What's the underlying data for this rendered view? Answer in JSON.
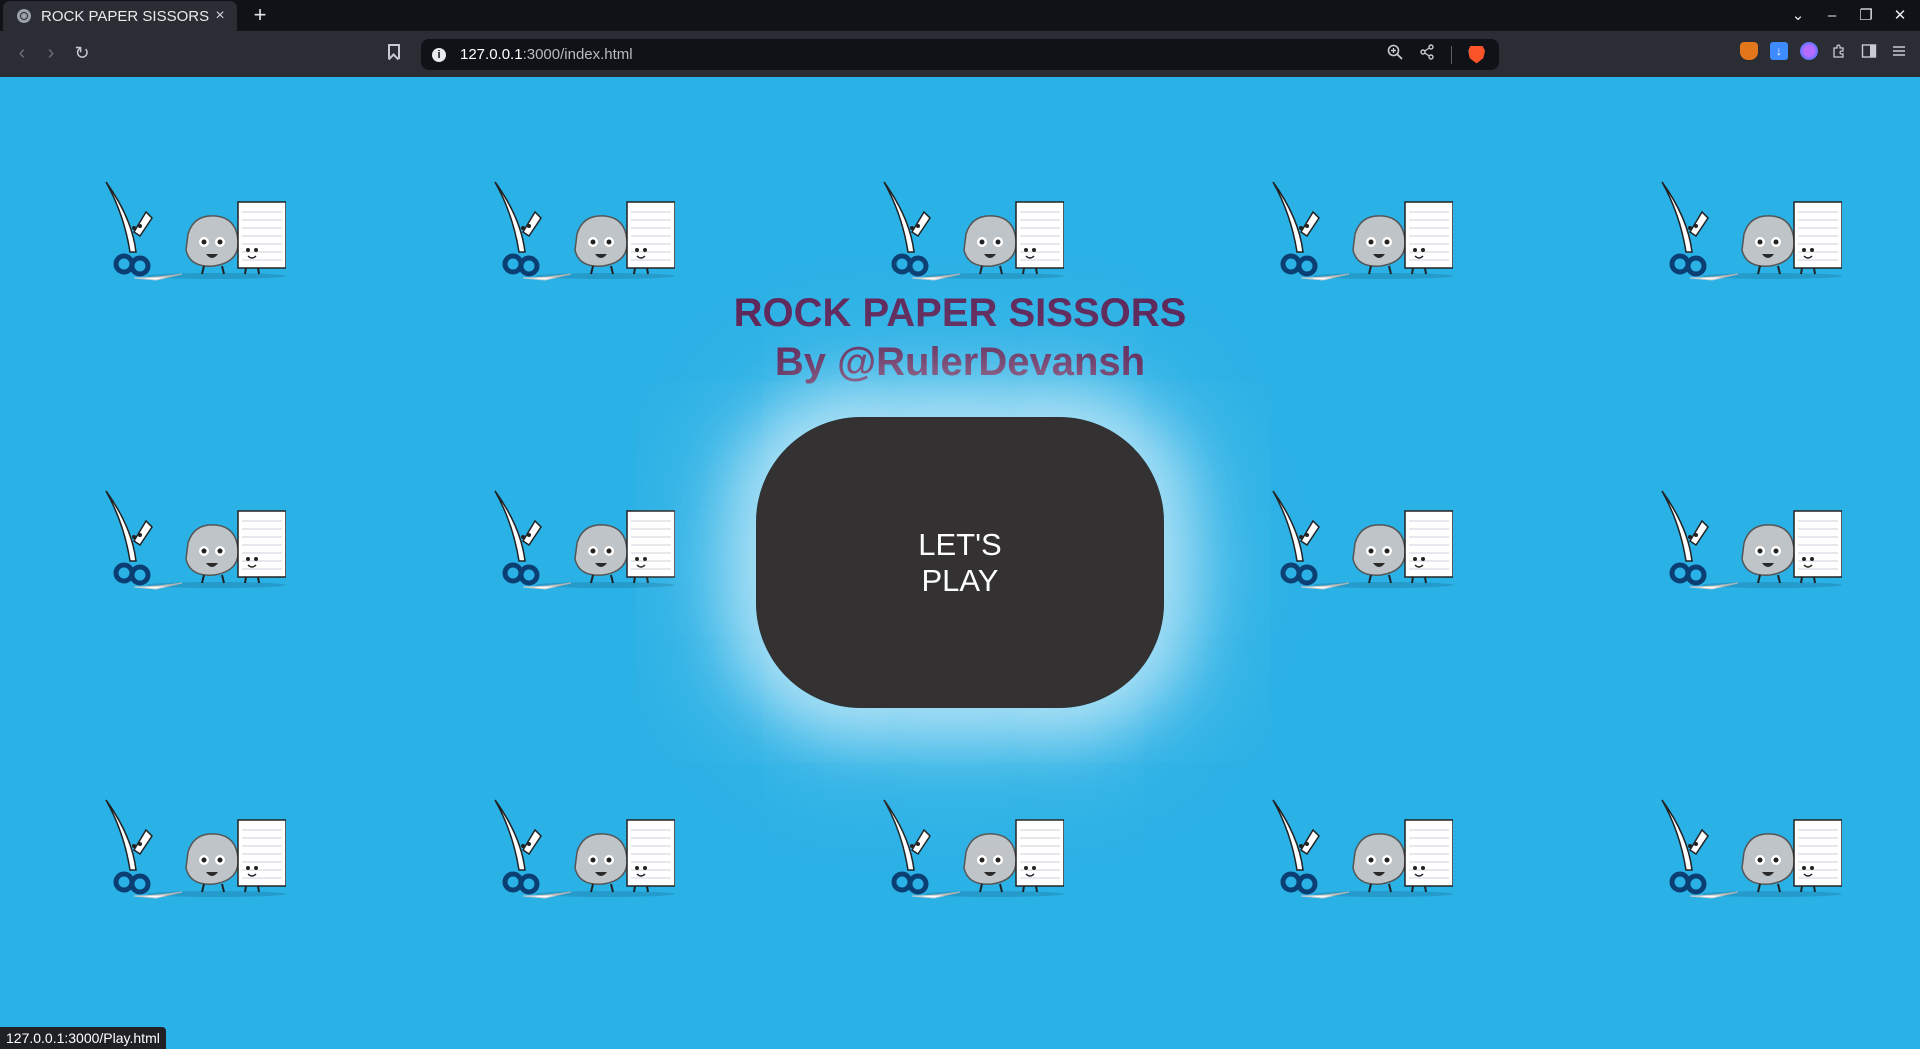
{
  "browser": {
    "tab": {
      "title": "ROCK PAPER SISSORS",
      "close": "×"
    },
    "new_tab": "+",
    "window_controls": {
      "list": "⌄",
      "minimize": "–",
      "restore": "❐",
      "close": "✕"
    },
    "url": {
      "host": "127.0.0.1",
      "path": ":3000/index.html"
    },
    "status_url": "127.0.0.1:3000/Play.html"
  },
  "page": {
    "title_line1": "ROCK PAPER SISSORS",
    "title_line2": "By @RulerDevansh",
    "play_button_label": "LET'S PLAY"
  },
  "colors": {
    "background": "#2ab1e6",
    "title": "#5d2659",
    "button": "#333132"
  },
  "icons": {
    "background_tile": "scissors-rock-paper-characters"
  }
}
